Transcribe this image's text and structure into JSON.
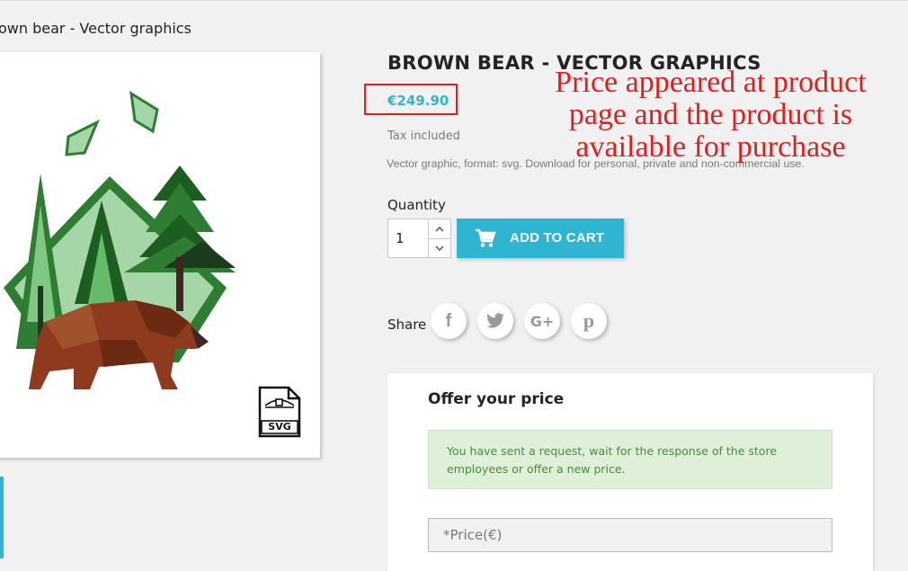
{
  "breadcrumb": {
    "current": "own bear - Vector graphics"
  },
  "product": {
    "title": "BROWN BEAR - VECTOR GRAPHICS",
    "price": "€249.90",
    "tax_note": "Tax included",
    "description": "Vector graphic, format: svg. Download for personal, private and non-commercial use.",
    "image_badge": "SVG"
  },
  "annotation": {
    "lines": [
      "Price appeared at product",
      "page and the product is",
      "available for purchase"
    ],
    "color": "#e01e1e"
  },
  "purchase": {
    "quantity_label": "Quantity",
    "quantity_value": "1",
    "add_to_cart_label": "ADD TO CART",
    "accent_color": "#2fb5d2"
  },
  "share": {
    "label": "Share",
    "networks": [
      {
        "name": "facebook",
        "glyph": "f"
      },
      {
        "name": "twitter",
        "glyph": ""
      },
      {
        "name": "google-plus",
        "glyph": "G+"
      },
      {
        "name": "pinterest",
        "glyph": "p"
      }
    ]
  },
  "offer": {
    "title": "Offer your price",
    "alert_text": "You have sent a request, wait for the response of the store employees or offer a new price.",
    "price_placeholder": "*Price(€)"
  }
}
